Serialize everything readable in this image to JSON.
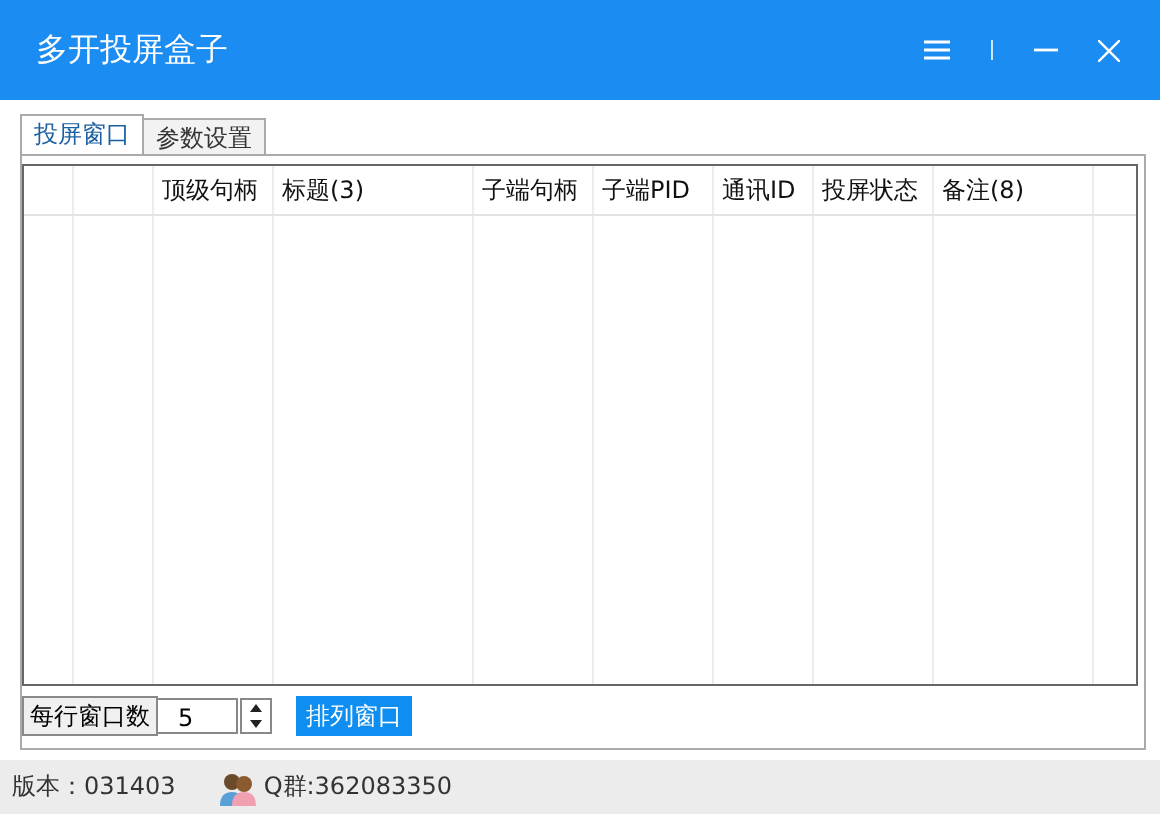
{
  "window": {
    "title": "多开投屏盒子"
  },
  "tabs": [
    {
      "label": "投屏窗口",
      "selected": true
    },
    {
      "label": "参数设置",
      "selected": false
    }
  ],
  "table": {
    "columns": [
      "顶级句柄",
      "标题(3)",
      "子端句柄",
      "子端PID",
      "通讯ID",
      "投屏状态",
      "备注(8)"
    ]
  },
  "controls": {
    "per_row_label": "每行窗口数",
    "per_row_value": "5",
    "arrange_button": "排列窗口"
  },
  "status_bar": {
    "version": "版本：031403",
    "qq_group": "Q群:362083350"
  }
}
